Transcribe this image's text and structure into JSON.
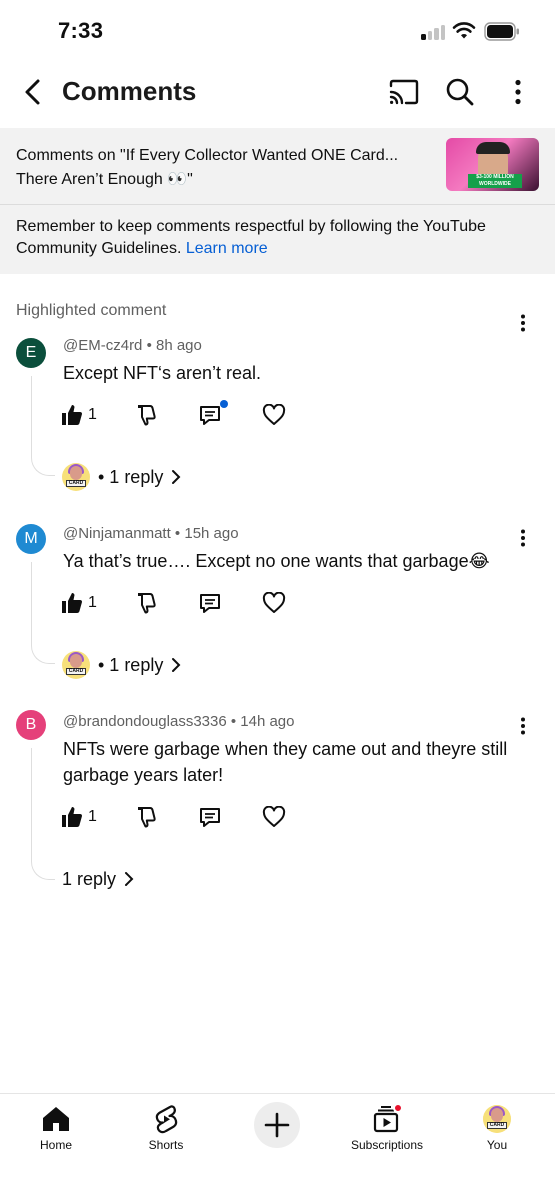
{
  "status_bar": {
    "time": "7:33"
  },
  "header": {
    "title": "Comments"
  },
  "video": {
    "info": "Comments on \"If Every Collector Wanted ONE Card... There Aren’t Enough 👀\"",
    "thumbnail_text": "$3-100 MILLION WORLDWIDE"
  },
  "guidelines": {
    "text": "Remember to keep comments respectful by following the YouTube Community Guidelines. ",
    "link": "Learn more"
  },
  "highlighted_label": "Highlighted comment",
  "comments": [
    {
      "avatar_letter": "E",
      "avatar_color": "#0b4f3c",
      "meta": "@EM-cz4rd • 8h ago",
      "text": "Except NFT‘s aren’t real.",
      "likes": "1",
      "reply_label": "• 1 reply"
    },
    {
      "avatar_letter": "M",
      "avatar_color": "#1f8ad2",
      "meta": "@Ninjamanmatt • 15h ago",
      "text": "Ya that’s true…. Except no one wants that garbage😂",
      "likes": "1",
      "reply_label": "• 1 reply"
    },
    {
      "avatar_letter": "B",
      "avatar_color": "#e5407a",
      "meta": "@brandondouglass3336 • 14h ago",
      "text": "NFTs were garbage when they came out and theyre still garbage years later!",
      "likes": "1",
      "reply_label": "1 reply"
    }
  ],
  "nav": {
    "home": "Home",
    "shorts": "Shorts",
    "subscriptions": "Subscriptions",
    "you": "You"
  },
  "colors": {
    "link": "#065fd4",
    "notification": "#e8112d",
    "panel": "#f2f2f2"
  },
  "icons": [
    "back-arrow-icon",
    "cast-icon",
    "search-icon",
    "more-vert-icon",
    "thumb-up-icon",
    "thumb-down-icon",
    "reply-comment-icon",
    "heart-icon",
    "chevron-right-icon",
    "home-icon",
    "shorts-icon",
    "plus-icon",
    "subscriptions-icon"
  ]
}
